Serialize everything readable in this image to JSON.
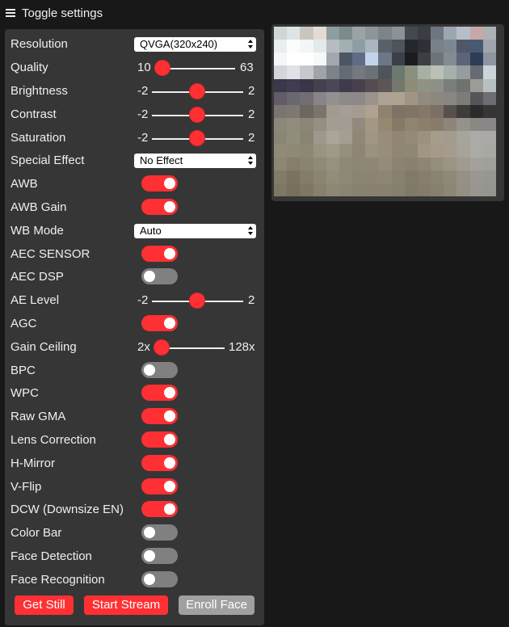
{
  "header": {
    "title": "Toggle settings",
    "menu_icon": "hamburger-icon"
  },
  "colors": {
    "accent": "#ff3034",
    "panel": "#363636",
    "background": "#181818",
    "toggle_off": "#808080",
    "button_disabled": "#a0a0a0"
  },
  "controls": {
    "resolution": {
      "label": "Resolution",
      "value": "QVGA(320x240)"
    },
    "quality": {
      "label": "Quality",
      "min": "10",
      "max": "63",
      "value": 10
    },
    "brightness": {
      "label": "Brightness",
      "min": "-2",
      "max": "2",
      "value": 0
    },
    "contrast": {
      "label": "Contrast",
      "min": "-2",
      "max": "2",
      "value": 0
    },
    "saturation": {
      "label": "Saturation",
      "min": "-2",
      "max": "2",
      "value": 0
    },
    "special_effect": {
      "label": "Special Effect",
      "value": "No Effect"
    },
    "awb": {
      "label": "AWB",
      "on": true
    },
    "awb_gain": {
      "label": "AWB Gain",
      "on": true
    },
    "wb_mode": {
      "label": "WB Mode",
      "value": "Auto"
    },
    "aec_sensor": {
      "label": "AEC SENSOR",
      "on": true
    },
    "aec_dsp": {
      "label": "AEC DSP",
      "on": false
    },
    "ae_level": {
      "label": "AE Level",
      "min": "-2",
      "max": "2",
      "value": 0
    },
    "agc": {
      "label": "AGC",
      "on": true
    },
    "gain_ceiling": {
      "label": "Gain Ceiling",
      "min": "2x",
      "max": "128x",
      "value": 0
    },
    "bpc": {
      "label": "BPC",
      "on": false
    },
    "wpc": {
      "label": "WPC",
      "on": true
    },
    "raw_gma": {
      "label": "Raw GMA",
      "on": true
    },
    "lens_correction": {
      "label": "Lens Correction",
      "on": true
    },
    "h_mirror": {
      "label": "H-Mirror",
      "on": true
    },
    "v_flip": {
      "label": "V-Flip",
      "on": true
    },
    "dcw": {
      "label": "DCW (Downsize EN)",
      "on": true
    },
    "color_bar": {
      "label": "Color Bar",
      "on": false
    },
    "face_detection": {
      "label": "Face Detection",
      "on": false
    },
    "face_recognition": {
      "label": "Face Recognition",
      "on": false
    }
  },
  "buttons": {
    "get_still": "Get Still",
    "start_stream": "Start Stream",
    "enroll_face": "Enroll Face"
  },
  "stream_pixels": [
    "#cfd6d6",
    "#dde4e6",
    "#c9c6c0",
    "#e6dbd2",
    "#8e9e9e",
    "#7e8a8a",
    "#9ba4a5",
    "#8c959a",
    "#7c848b",
    "#8e9296",
    "#44484f",
    "#3a3d44",
    "#6d757e",
    "#9aa7b0",
    "#b8bec8",
    "#c6a9a6",
    "#adb0b4",
    "#e9eef0",
    "#fbfdfd",
    "#f2f6f6",
    "#e4e9ea",
    "#b6bcbf",
    "#a3b0b3",
    "#8f9da6",
    "#aab5c0",
    "#5a6069",
    "#4d545b",
    "#25272d",
    "#2e3036",
    "#788088",
    "#7b8891",
    "#4e5868",
    "#4a5973",
    "#9fa5ab",
    "#f4f7f7",
    "#ffffff",
    "#ffffff",
    "#f6f9f9",
    "#a0a8ad",
    "#4b5564",
    "#5f6d84",
    "#c2d4ec",
    "#6c7888",
    "#3c4049",
    "#1b1c20",
    "#3c3e44",
    "#6d7479",
    "#848b92",
    "#5b6478",
    "#2d3d58",
    "#8d95a1",
    "#d2d5d9",
    "#dfe2e6",
    "#c5c9cd",
    "#9fa3aa",
    "#7d8188",
    "#646b74",
    "#74797f",
    "#6a7177",
    "#4e5459",
    "#6b7a6f",
    "#8b8f7e",
    "#a7b0a5",
    "#bbbfb5",
    "#a5b0ad",
    "#979c9e",
    "#666c72",
    "#ccd4d7",
    "#3b384a",
    "#413c50",
    "#3a3648",
    "#45404e",
    "#4b4756",
    "#3f3b4a",
    "#48414d",
    "#574b52",
    "#5d5556",
    "#75786c",
    "#8c8c77",
    "#909384",
    "#8e8f87",
    "#7b7f7b",
    "#6f736e",
    "#9c9c96",
    "#b8bfc3",
    "#615c66",
    "#6b6771",
    "#716d74",
    "#8a8489",
    "#94908f",
    "#8d8a89",
    "#8e8987",
    "#9a928b",
    "#ada394",
    "#aea390",
    "#a09584",
    "#928a7f",
    "#8c877f",
    "#8a8783",
    "#7d7c7b",
    "#565658",
    "#6c6e71",
    "#7a7570",
    "#7e7873",
    "#6c6660",
    "#7b746c",
    "#a29a8f",
    "#a49e96",
    "#a49c91",
    "#aea390",
    "#8f826f",
    "#7d7263",
    "#7d7566",
    "#85786a",
    "#7c6f65",
    "#57514d",
    "#3f3c3a",
    "#2c2b2b",
    "#373636",
    "#8b8779",
    "#918c7c",
    "#8c8679",
    "#948e83",
    "#a39c91",
    "#a49c92",
    "#928a7e",
    "#a49883",
    "#958974",
    "#867a66",
    "#8e8471",
    "#8b7f6b",
    "#877c6c",
    "#8e857a",
    "#96918b",
    "#8b8884",
    "#898787",
    "#8a8675",
    "#928e7d",
    "#888574",
    "#9d988b",
    "#aaa598",
    "#a49d90",
    "#8f8777",
    "#a19683",
    "#998d7a",
    "#918674",
    "#948a77",
    "#9b917e",
    "#a59c8a",
    "#a29c8f",
    "#a7a49c",
    "#acaaa7",
    "#aaa9a8",
    "#8f8b78",
    "#8d8975",
    "#8d8873",
    "#999380",
    "#9f9987",
    "#978f7e",
    "#8d8674",
    "#9a917e",
    "#978d7a",
    "#8f8674",
    "#8f8673",
    "#a09683",
    "#a49a87",
    "#a49d8e",
    "#a7a399",
    "#ababa5",
    "#a7a7a4",
    "#8c8672",
    "#847e6b",
    "#8a846f",
    "#8f8a76",
    "#959080",
    "#8e8878",
    "#8c8676",
    "#8f8776",
    "#948b79",
    "#8c8473",
    "#888070",
    "#8e8675",
    "#968e7d",
    "#9a9484",
    "#9f9b90",
    "#a3a19a",
    "#9f9f9b",
    "#827b67",
    "#7a735f",
    "#827c68",
    "#8a8571",
    "#928d7b",
    "#8d8877",
    "#898474",
    "#8c8574",
    "#8e8674",
    "#888070",
    "#817a6a",
    "#867e6e",
    "#8a8373",
    "#8f897a",
    "#959187",
    "#9a9891",
    "#979792",
    "#7e7762",
    "#786f5b",
    "#7f7763",
    "#86806c",
    "#8d8775",
    "#8a8473",
    "#878170",
    "#898170",
    "#8a8270",
    "#85806e",
    "#7f7968",
    "#837b6b",
    "#877f6f",
    "#8c8677",
    "#938f85",
    "#98968f",
    "#95958f"
  ]
}
